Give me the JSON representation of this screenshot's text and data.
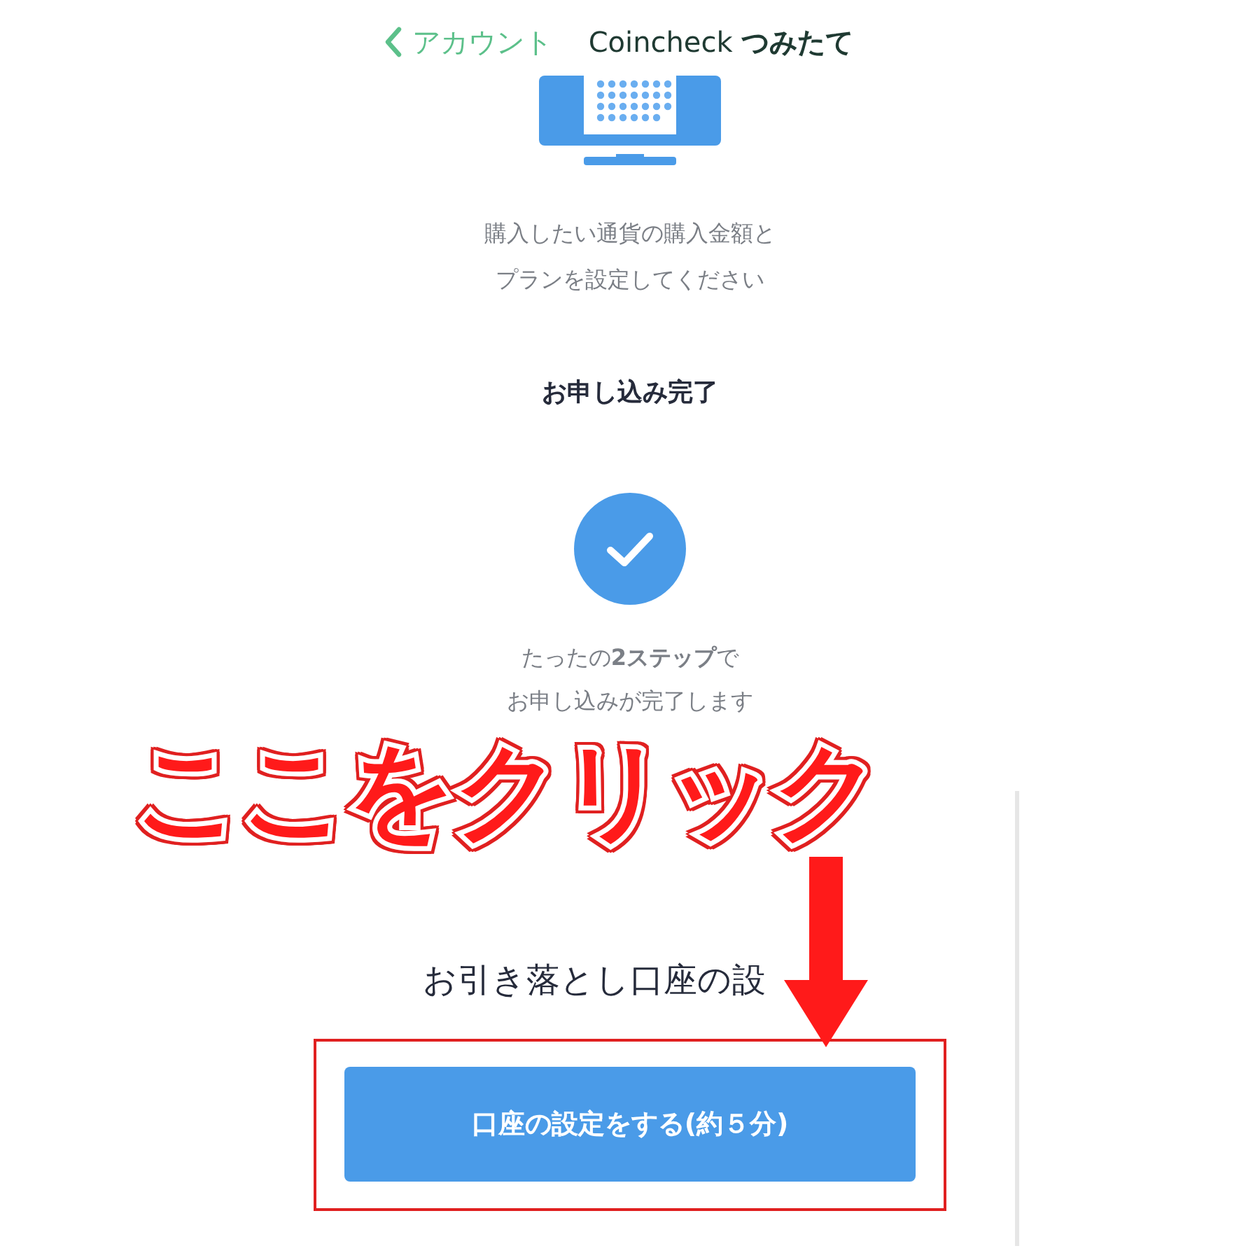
{
  "header": {
    "back_label": "アカウント",
    "title": "Coincheck **つみたて**"
  },
  "step_purchase": {
    "description_lines": [
      "購入したい通貨の購入金額と",
      "プランを設定してください"
    ]
  },
  "step_complete": {
    "heading": "お申し込み完了",
    "description_lines": [
      "たったの**2ステップ**で",
      "お申し込みが完了します"
    ]
  },
  "account_setup": {
    "heading": "お引き落とし口座の設",
    "button": "口座の設定をする(約５分)"
  },
  "annotation": {
    "callout": "ここをクリック"
  }
}
